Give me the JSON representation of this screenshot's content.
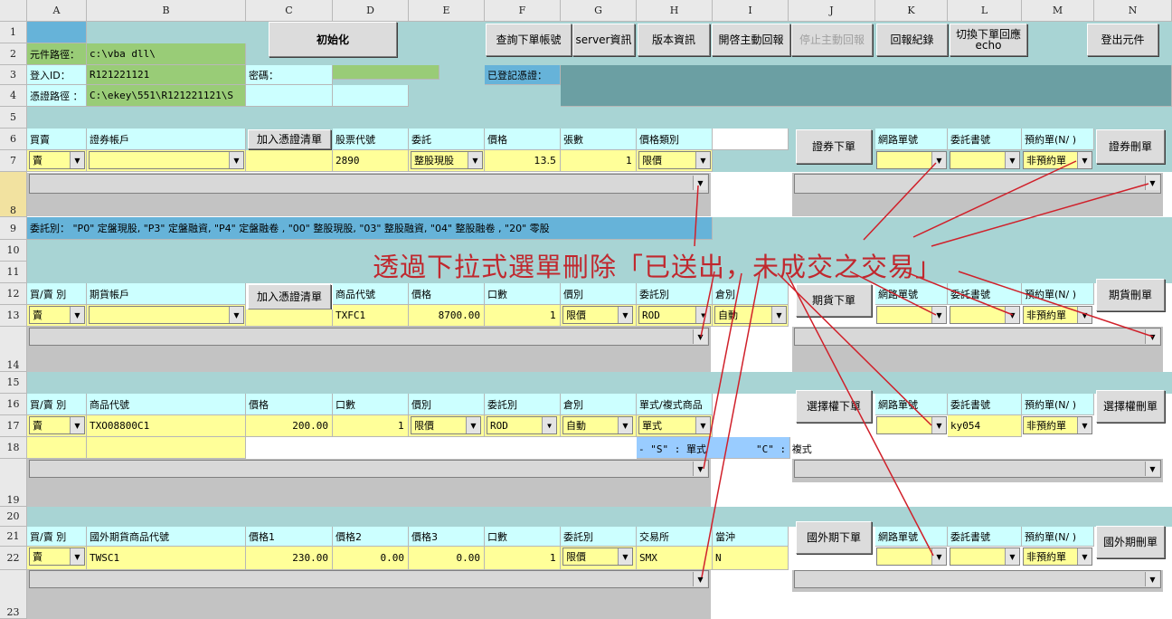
{
  "columns": [
    "A",
    "B",
    "C",
    "D",
    "E",
    "F",
    "G",
    "H",
    "I",
    "J",
    "K",
    "L",
    "M",
    "N"
  ],
  "rows": [
    "1",
    "2",
    "3",
    "4",
    "5",
    "6",
    "7",
    "8",
    "9",
    "10",
    "11",
    "12",
    "13",
    "14",
    "15",
    "16",
    "17",
    "18",
    "19",
    "20",
    "21",
    "22",
    "23"
  ],
  "buttons": {
    "init": "初始化",
    "query_account": "查詢下單帳號",
    "server_info": "server資訊",
    "version_info": "版本資訊",
    "start_report": "開啓主動回報",
    "stop_report": "停止主動回報",
    "report_log": "回報紀錄",
    "switch_echo_line1": "切換下單回應",
    "switch_echo_line2": "echo",
    "logout": "登出元件",
    "add_cert_1": "加入憑證清單",
    "add_cert_2": "加入憑證清單",
    "stock_order": "證券下單",
    "stock_delete": "證券刪單",
    "futures_order": "期貨下單",
    "futures_delete": "期貨刪單",
    "options_order": "選擇權下單",
    "options_delete": "選擇權刪單",
    "foreign_order": "國外期下單",
    "foreign_delete": "國外期刪單"
  },
  "info": {
    "dll_path_label": "元件路徑：",
    "dll_path_value": "c:\\vba dll\\",
    "login_id_label": "登入ID：",
    "login_id_value": "R121221121",
    "password_label": "密碼：",
    "cert_path_label": "憑證路徑 ：",
    "cert_path_value": "C:\\ekey\\551\\R121221121\\S",
    "registered_cert_label": "已登記憑證："
  },
  "stock": {
    "headers": [
      "買賣",
      "證券帳戶",
      "股票代號",
      "委託",
      "價格",
      "張數",
      "價格類別",
      "網路單號",
      "委託書號",
      "預約單(N/ )"
    ],
    "side": "賣",
    "symbol": "2890",
    "order_type": "整股現股",
    "price": "13.5",
    "qty": "1",
    "price_type": "限價",
    "reserve": "非預約單"
  },
  "legend_row9": "委託別：  \"P0\" 定盤現股, \"P3\" 定盤融資, \"P4\" 定盤融卷 , \"00\" 整股現股, \"03\" 整股融資, \"04\" 整股融卷 , \"20\" 零股",
  "futures": {
    "headers": [
      "買/賣 別",
      "期貨帳戶",
      "商品代號",
      "價格",
      "口數",
      "價別",
      "委託別",
      "倉別",
      "網路單號",
      "委託書號",
      "預約單(N/ )"
    ],
    "side": "賣",
    "symbol": "TXFC1",
    "price": "8700.00",
    "qty": "1",
    "price_type": "限價",
    "order_kind": "ROD",
    "position": "自動",
    "reserve": "非預約單"
  },
  "options": {
    "headers": [
      "買/賣 別",
      "商品代號",
      "價格",
      "口數",
      "價別",
      "委託別",
      "倉別",
      "單式/複式商品",
      "網路單號",
      "委託書號",
      "預約單(N/ )"
    ],
    "side": "賣",
    "symbol": "TXO08800C1",
    "price": "200.00",
    "qty": "1",
    "price_type": "限價",
    "order_kind": "ROD",
    "position": "自動",
    "combo": "單式",
    "book_no": "ky054",
    "reserve": "非預約單",
    "note_s": "- \"S\" : 單式",
    "note_c": "\"C\" : 複式"
  },
  "foreign": {
    "headers": [
      "買/賣 別",
      "國外期貨商品代號",
      "價格1",
      "價格2",
      "價格3",
      "口數",
      "委託別",
      "交易所",
      "當沖",
      "網路單號",
      "委託書號",
      "預約單(N/ )"
    ],
    "side": "賣",
    "symbol": "TWSC1",
    "price1": "230.00",
    "price2": "0.00",
    "price3": "0.00",
    "qty": "1",
    "order_kind": "限價",
    "exchange": "SMX",
    "daytrade": "N",
    "reserve": "非預約單"
  },
  "annotation": "透過下拉式選單刪除「已送出，未成交之交易」",
  "colors": {
    "label_bg": "#ccffff",
    "input_bg": "#ffff99",
    "path_bg": "#99cc77",
    "accent_blue": "#66b3d9",
    "annotation": "#c0282e"
  }
}
